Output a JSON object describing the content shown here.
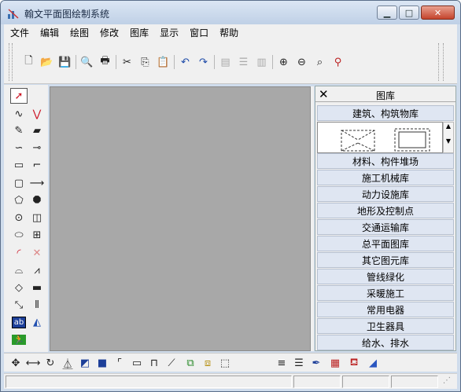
{
  "window": {
    "title": "翰文平面图绘制系统"
  },
  "menu": [
    "文件",
    "编辑",
    "绘图",
    "修改",
    "图库",
    "显示",
    "窗口",
    "帮助"
  ],
  "library": {
    "title": "图库",
    "categories": [
      "建筑、构筑物库",
      "材料、构件堆场",
      "施工机械库",
      "动力设施库",
      "地形及控制点",
      "交通运输库",
      "总平面图库",
      "其它图元库",
      "管线绿化",
      "采暖施工",
      "常用电器",
      "卫生器具",
      "给水、排水"
    ]
  },
  "toolbox": {
    "text_tool_label": "ab"
  }
}
